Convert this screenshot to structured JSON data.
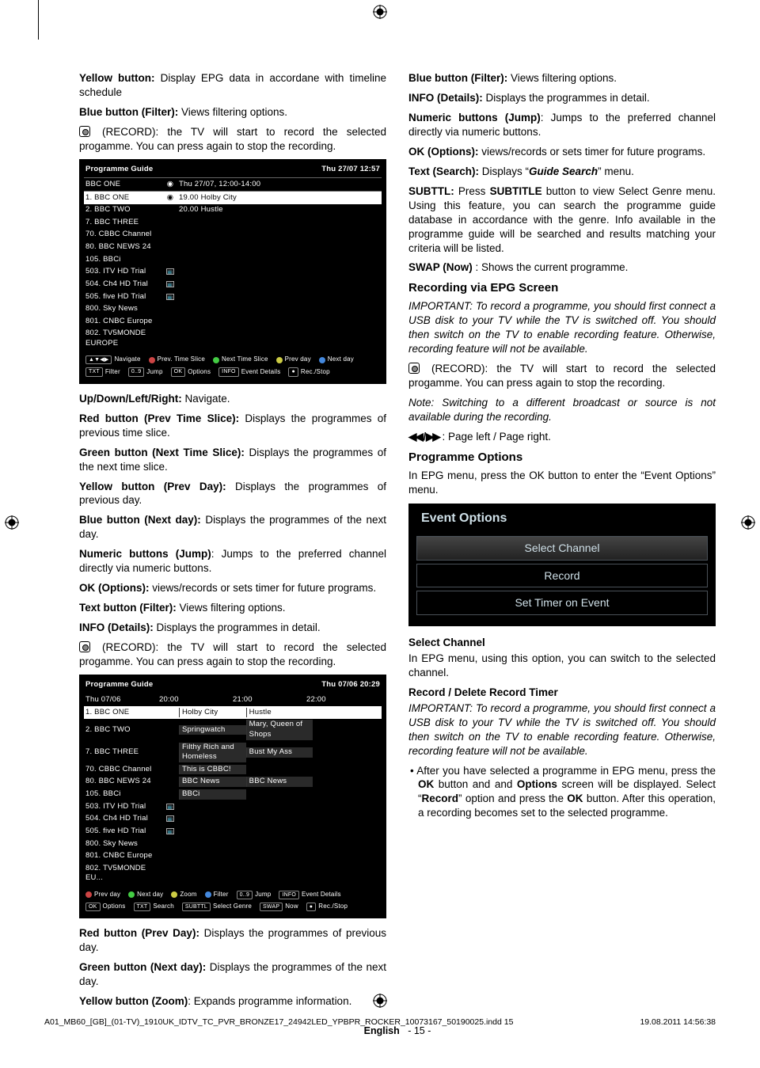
{
  "left": {
    "p1_a": "Yellow button:",
    "p1_b": " Display EPG data in accordane with timeline schedule",
    "p2_a": "Blue button (Filter):",
    "p2_b": " Views filtering options.",
    "p3_b": " (RECORD): the TV will start to record the selected progamme. You can press again to stop the recording.",
    "p4_a": "Up/Down/Left/Right:",
    "p4_b": " Navigate.",
    "p5_a": "Red button (Prev Time Slice):",
    "p5_b": " Displays the programmes of previous time slice.",
    "p6_a": "Green button (Next Time Slice):",
    "p6_b": " Displays the programmes of the next time slice.",
    "p7_a": "Yellow button (Prev Day):",
    "p7_b": " Displays the programmes of previous day.",
    "p8_a": "Blue button (Next day):",
    "p8_b": " Displays the programmes of the next day.",
    "p9_a": "Numeric buttons (Jump)",
    "p9_b": ": Jumps to the preferred channel directly via numeric buttons.",
    "p10_a": "OK (Options):",
    "p10_b": " views/records or sets timer for future programs.",
    "p11_a": "Text button (Filter):",
    "p11_b": " Views filtering options.",
    "p12_a": "INFO (Details):",
    "p12_b": " Displays the programmes in detail.",
    "p13_b": " (RECORD): the TV will start to record the selected progamme. You can press again to stop the recording.",
    "p14_a": "Red button (Prev Day):",
    "p14_b": " Displays the programmes of previous day.",
    "p15_a": "Green button (Next day):",
    "p15_b": " Displays the programmes of the next day.",
    "p16_a": "Yellow button (Zoom)",
    "p16_b": ": Expands programme information."
  },
  "right": {
    "p1_a": "Blue button (Filter):",
    "p1_b": " Views filtering options.",
    "p2_a": "INFO (Details):",
    "p2_b": " Displays the programmes in detail.",
    "p3_a": "Numeric buttons (Jump)",
    "p3_b": ": Jumps to the preferred channel directly via numeric buttons.",
    "p4_a": "OK (Options):",
    "p4_b": " views/records or sets timer for future programs.",
    "p5_a": "Text (Search):",
    "p5_b": " Displays “",
    "p5_c": "Guide Search",
    "p5_d": "” menu.",
    "p6_a": "SUBTTL:",
    "p6_b": " Press ",
    "p6_c": "SUBTITLE",
    "p6_d": " button to view Select Genre menu. Using this feature, you can search the programme guide database in accordance with the genre. Info available in the programme guide will be searched and results matching your criteria will be listed.",
    "p7_a": "SWAP (Now)",
    "p7_b": " : Shows the current programme.",
    "h1": "Recording via EPG Screen",
    "p8": "IMPORTANT: To record a programme, you should first connect a USB disk to your TV while the TV is switched off. You should then switch on the TV to enable recording feature. Otherwise, recording feature will not be available.",
    "p9_b": " (RECORD): the TV will start to record the selected progamme. You can press again to stop the recording.",
    "p10": "Note: Switching to a different broadcast or source is not available during the recording.",
    "p11_a": "◀◀ / ▶▶",
    "p11_b": " : Page left / Page right.",
    "h2": "Programme Options",
    "p12": "In EPG menu, press the OK button to enter the “Event Options” menu.",
    "h3": "Select Channel",
    "p13": "In EPG menu, using this option, you can switch to the selected channel.",
    "h4": "Record / Delete Record Timer",
    "p14": "IMPORTANT: To record a programme, you should first connect a USB disk to your TV while the TV is switched off. You should then switch on the TV to enable recording feature. Otherwise, recording feature will not be available.",
    "p15_a": "• After you have selected a programme in EPG menu, press the ",
    "p15_b": "OK",
    "p15_c": " button and and ",
    "p15_d": "Options",
    "p15_e": " screen will be displayed. Select “",
    "p15_f": "Record",
    "p15_g": "” option and press the ",
    "p15_h": "OK",
    "p15_i": " button. After this operation, a recording becomes set to the selected programme."
  },
  "epg1": {
    "title": "Programme Guide",
    "time": "Thu 27/07 12:57",
    "hdr_ch": "BBC ONE",
    "hdr_tm": "Thu 27/07, 12:00-14:00",
    "rows": [
      {
        "n": "1. BBC ONE",
        "p": "19.00 Holby City"
      },
      {
        "n": "2. BBC TWO",
        "p": "20.00 Hustle"
      },
      {
        "n": "7. BBC THREE",
        "p": ""
      },
      {
        "n": "70. CBBC Channel",
        "p": ""
      },
      {
        "n": "80. BBC NEWS 24",
        "p": ""
      },
      {
        "n": "105. BBCi",
        "p": ""
      },
      {
        "n": "503. ITV HD Trial",
        "p": ""
      },
      {
        "n": "504. Ch4 HD Trial",
        "p": ""
      },
      {
        "n": "505. five HD Trial",
        "p": ""
      },
      {
        "n": "800. Sky News",
        "p": ""
      },
      {
        "n": "801. CNBC Europe",
        "p": ""
      },
      {
        "n": "802. TV5MONDE EUROPE",
        "p": ""
      }
    ],
    "hints": [
      "Navigate",
      "Prev. Time Slice",
      "Next Time Slice",
      "Prev day",
      "Next day",
      "Filter",
      "Jump",
      "Options",
      "Event Details",
      "Rec./Stop"
    ]
  },
  "epg2": {
    "title": "Programme Guide",
    "time": "Thu 07/06 20:29",
    "cols": [
      "Thu 07/06",
      "20:00",
      "21:00",
      "22:00"
    ],
    "rows": [
      {
        "n": "1. BBC ONE",
        "c": [
          "Holby City",
          "Hustle",
          ""
        ]
      },
      {
        "n": "2. BBC TWO",
        "c": [
          "Springwatch",
          "Mary, Queen of Shops",
          ""
        ]
      },
      {
        "n": "7. BBC THREE",
        "c": [
          "Filthy Rich and Homeless",
          "Bust My Ass",
          ""
        ]
      },
      {
        "n": "70. CBBC Channel",
        "c": [
          "This is CBBC!",
          "",
          ""
        ]
      },
      {
        "n": "80. BBC NEWS 24",
        "c": [
          "BBC News",
          "BBC News",
          ""
        ]
      },
      {
        "n": "105. BBCi",
        "c": [
          "BBCi",
          "",
          ""
        ]
      },
      {
        "n": "503. ITV HD Trial",
        "c": [
          "",
          "",
          ""
        ]
      },
      {
        "n": "504. Ch4 HD Trial",
        "c": [
          "",
          "",
          ""
        ]
      },
      {
        "n": "505. five HD Trial",
        "c": [
          "",
          "",
          ""
        ]
      },
      {
        "n": "800. Sky News",
        "c": [
          "",
          "",
          ""
        ]
      },
      {
        "n": "801. CNBC Europe",
        "c": [
          "",
          "",
          ""
        ]
      },
      {
        "n": "802. TV5MONDE EU...",
        "c": [
          "",
          "",
          ""
        ]
      }
    ],
    "hints": [
      "Prev day",
      "Next day",
      "Zoom",
      "Filter",
      "Jump",
      "Event Details",
      "Options",
      "Search",
      "Select Genre",
      "Now",
      "Rec./Stop"
    ]
  },
  "evopts": {
    "title": "Event Options",
    "items": [
      "Select Channel",
      "Record",
      "Set Timer on Event"
    ]
  },
  "footer": {
    "lang": "English",
    "page": "- 15 -"
  },
  "imprint": {
    "file": "A01_MB60_[GB]_(01-TV)_1910UK_IDTV_TC_PVR_BRONZE17_24942LED_YPBPR_ROCKER_10073167_50190025.indd   15",
    "date": "19.08.2011   14:56:38"
  }
}
